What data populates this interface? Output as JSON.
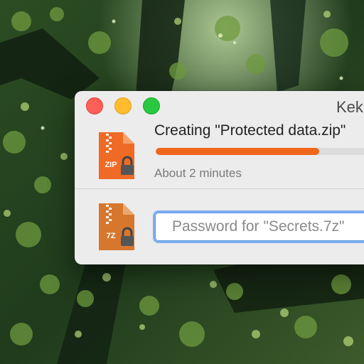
{
  "window": {
    "title": "Kek"
  },
  "operations": [
    {
      "icon": "zip-archive-locked-icon",
      "icon_label": "ZIP",
      "title": "Creating \"Protected data.zip\"",
      "progress": 0.72,
      "status": "About 2 minutes"
    },
    {
      "icon": "7z-archive-locked-icon",
      "icon_label": "7Z",
      "password_placeholder": "Password for \"Secrets.7z\"",
      "password_value": ""
    }
  ],
  "colors": {
    "progress_fill": "#f0661b",
    "zip_icon": "#ef6a25",
    "sevenz_icon": "#d7772d",
    "focus_ring": "#7eaff0"
  }
}
